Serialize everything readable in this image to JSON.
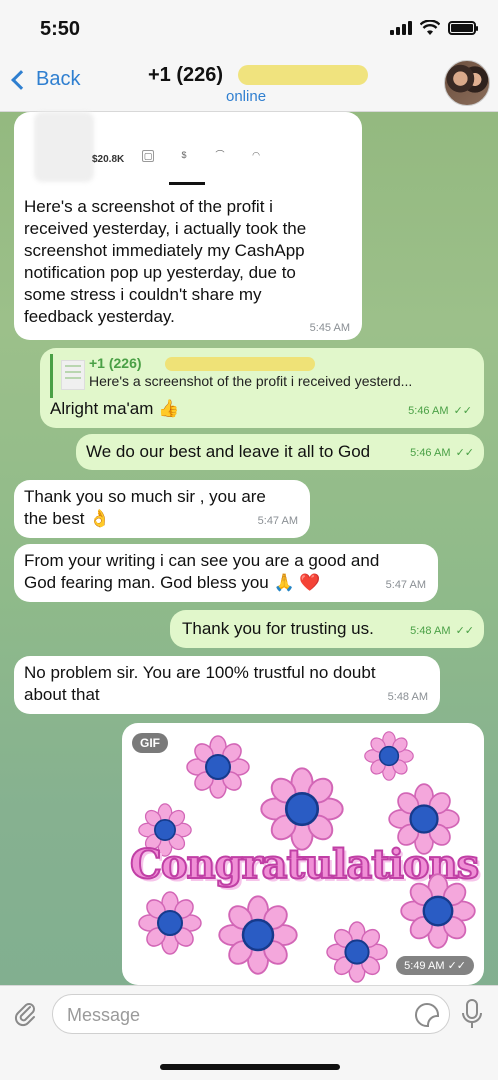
{
  "status_bar": {
    "time": "5:50"
  },
  "header": {
    "back_label": "Back",
    "contact_name": "+1 (226)",
    "contact_status": "online"
  },
  "messages": [
    {
      "direction": "in",
      "preview": {
        "amount": "$20.8K"
      },
      "text": "Here's a screenshot of the profit i received yesterday, i actually took the screenshot immediately my CashApp notification pop up yesterday, due to some stress i couldn't share my feedback yesterday.",
      "lines": [
        "Here's a screenshot of the profit i",
        "received yesterday, i actually took the",
        "screenshot immediately my CashApp",
        "notification pop up yesterday, due to",
        "some stress i couldn't share my",
        "feedback yesterday."
      ],
      "time": "5:45 AM"
    },
    {
      "direction": "out",
      "reply_name": "+1 (226)",
      "reply_text": "Here's a screenshot of the profit i received yesterd...",
      "text": "Alright ma'am 👍",
      "time": "5:46 AM"
    },
    {
      "direction": "out",
      "text": "We do our best and leave it all to God",
      "time": "5:46 AM"
    },
    {
      "direction": "in",
      "lines": [
        "Thank you so much sir , you are",
        "the best 👌"
      ],
      "time": "5:47 AM"
    },
    {
      "direction": "in",
      "lines": [
        "From your writing i can see you are a good and",
        "God fearing man. God bless you 🙏 ❤️"
      ],
      "time": "5:47 AM"
    },
    {
      "direction": "out",
      "text": "Thank you for trusting us.",
      "time": "5:48 AM"
    },
    {
      "direction": "in",
      "lines": [
        "No problem sir. You are 100% trustful no doubt",
        "about that"
      ],
      "time": "5:48 AM"
    },
    {
      "direction": "in",
      "type": "gif",
      "badge": "GIF",
      "gif_text": "Congratulations",
      "time": "5:49 AM"
    }
  ],
  "input": {
    "placeholder": "Message"
  },
  "colors": {
    "accent": "#2f7fd0",
    "outgoing": "#e1f7cb",
    "incoming": "#ffffff",
    "check": "#4aa046"
  },
  "icons": [
    "back-chevron-icon",
    "attach-icon",
    "sticker-icon",
    "microphone-icon",
    "signal-icon",
    "wifi-icon",
    "battery-icon"
  ]
}
